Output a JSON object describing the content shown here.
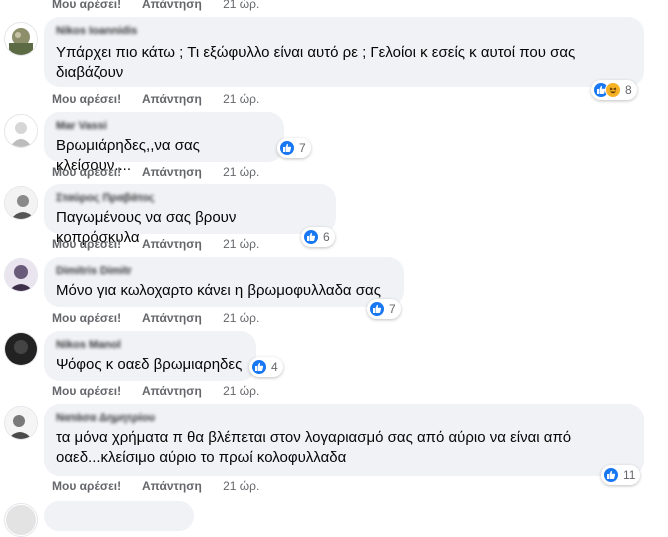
{
  "top_actions": {
    "like": "Μου αρέσει!",
    "reply": "Απάντηση",
    "time": "21 ώρ."
  },
  "comments": [
    {
      "author": "Nikos Ioannidis",
      "text": "Υπάρχει πιο κάτω ; Τι εξώφυλλο είναι αυτό ρε ; Γελοίοι κ εσείς κ αυτοί που σας διαβάζουν",
      "reaction_count": "8",
      "like": "Μου αρέσει!",
      "reply": "Απάντηση",
      "time": "21 ώρ."
    },
    {
      "author": "Mar Vassi",
      "text": "Βρωμιάρηδες,,να σας κλείσουν....",
      "reaction_count": "7",
      "like": "Μου αρέσει!",
      "reply": "Απάντηση",
      "time": "21 ώρ."
    },
    {
      "author": "Σταύρος Πραβάτος",
      "text": "Παγωμένους να σας βρουν κοπρόσκυλα",
      "reaction_count": "6",
      "like": "Μου αρέσει!",
      "reply": "Απάντηση",
      "time": "21 ώρ."
    },
    {
      "author": "Dimitris Dimitr",
      "text": "Μόνο για κωλοχαρτο κάνει η βρωμοφυλλαδα σας",
      "reaction_count": "7",
      "like": "Μου αρέσει!",
      "reply": "Απάντηση",
      "time": "21 ώρ."
    },
    {
      "author": "Nikos Manol",
      "text": "Ψόφος κ οαεδ βρωμιαρηδες",
      "reaction_count": "4",
      "like": "Μου αρέσει!",
      "reply": "Απάντηση",
      "time": "21 ώρ."
    },
    {
      "author": "Νατάσα Δημητρίου",
      "text": "τα μόνα χρήματα π θα βλέπεται στον λογαριασμό σας από αύριο να είναι από οαεδ...κλείσιμο αύριο το πρωί κολοφυλλαδα",
      "reaction_count": "11",
      "like": "Μου αρέσει!",
      "reply": "Απάντηση",
      "time": "21 ώρ."
    }
  ],
  "icons": {
    "like": "like-icon",
    "haha": "haha-icon"
  },
  "colors": {
    "bubble": "#f0f2f5",
    "like_blue": "#1877f2",
    "haha_yellow": "#f7b125",
    "secondary_text": "#65676b"
  }
}
